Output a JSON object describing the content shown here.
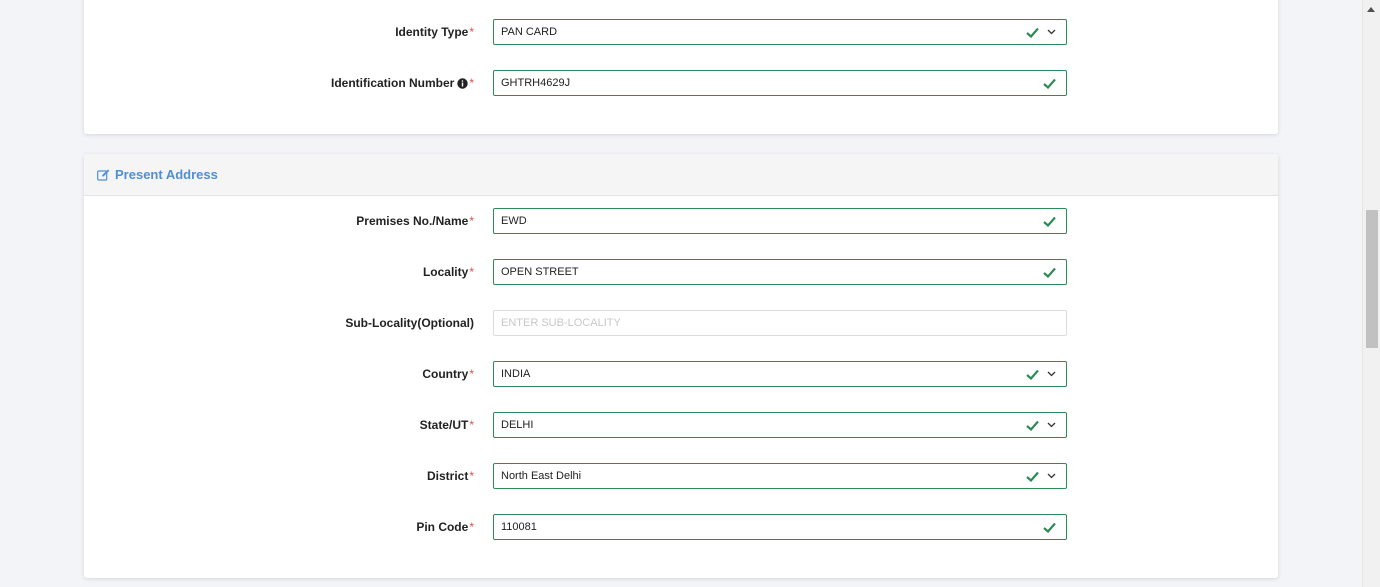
{
  "identity": {
    "type_label": "Identity Type",
    "type_value": "PAN CARD",
    "number_label": "Identification Number",
    "number_value": "GHTRH4629J"
  },
  "present_address": {
    "title": "Present Address",
    "fields": {
      "premises": {
        "label": "Premises No./Name",
        "value": "EWD"
      },
      "locality": {
        "label": "Locality",
        "value": "OPEN STREET"
      },
      "sub_locality": {
        "label": "Sub-Locality(Optional)",
        "value": "",
        "placeholder": "ENTER SUB-LOCALITY"
      },
      "country": {
        "label": "Country",
        "value": "INDIA"
      },
      "state": {
        "label": "State/UT",
        "value": "DELHI"
      },
      "district": {
        "label": "District",
        "value": "North East Delhi"
      },
      "pincode": {
        "label": "Pin Code",
        "value": "110081"
      }
    }
  },
  "required_marker": "*",
  "colors": {
    "valid_border": "#2e8b57",
    "check": "#2e8b57",
    "required": "#d9534f",
    "section_title": "#4f8fd6"
  },
  "icons": {
    "valid": "check-icon",
    "dropdown": "chevron-down-icon",
    "info": "info-circle-icon",
    "section": "edit-icon"
  }
}
